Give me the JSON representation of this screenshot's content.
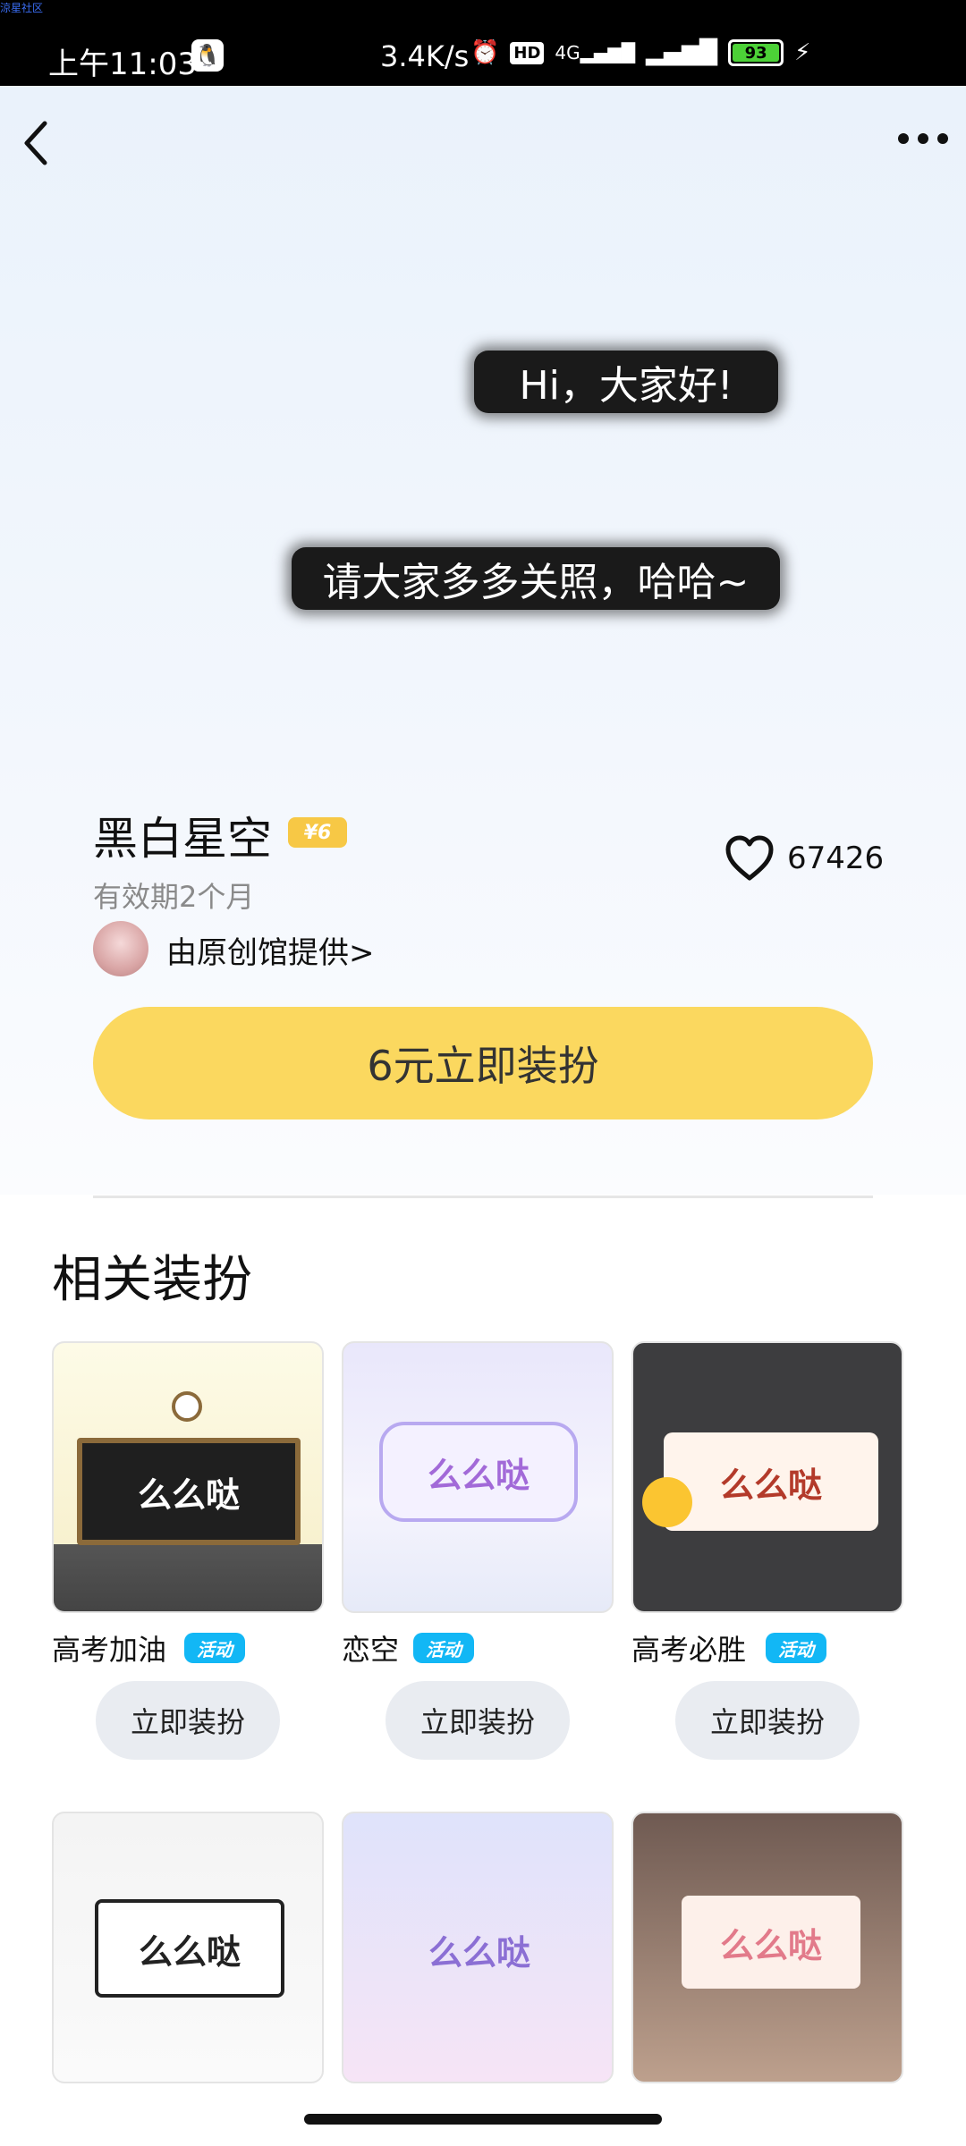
{
  "watermark": "涼星社区",
  "status": {
    "time": "上午11:03",
    "speed": "3.4K/s",
    "hd": "HD",
    "network": "4G",
    "battery": "93"
  },
  "hero": {
    "bubble_1": "Hi，大家好!",
    "bubble_2": "请大家多多关照，哈哈~"
  },
  "item": {
    "title": "黑白星空",
    "price_badge": "¥6",
    "validity": "有效期2个月",
    "provider": "由原创馆提供>",
    "likes": "67426",
    "cta": "6元立即装扮"
  },
  "section": {
    "title": "相关装扮"
  },
  "related": [
    {
      "name": "高考加油",
      "badge": "活动",
      "apply": "立即装扮",
      "preview_text": "么么哒"
    },
    {
      "name": "恋空",
      "badge": "活动",
      "apply": "立即装扮",
      "preview_text": "么么哒"
    },
    {
      "name": "高考必胜",
      "badge": "活动",
      "apply": "立即装扮",
      "preview_text": "么么哒"
    },
    {
      "preview_text": "么么哒"
    },
    {
      "preview_text": "么么哒"
    },
    {
      "preview_text": "么么哒"
    }
  ]
}
